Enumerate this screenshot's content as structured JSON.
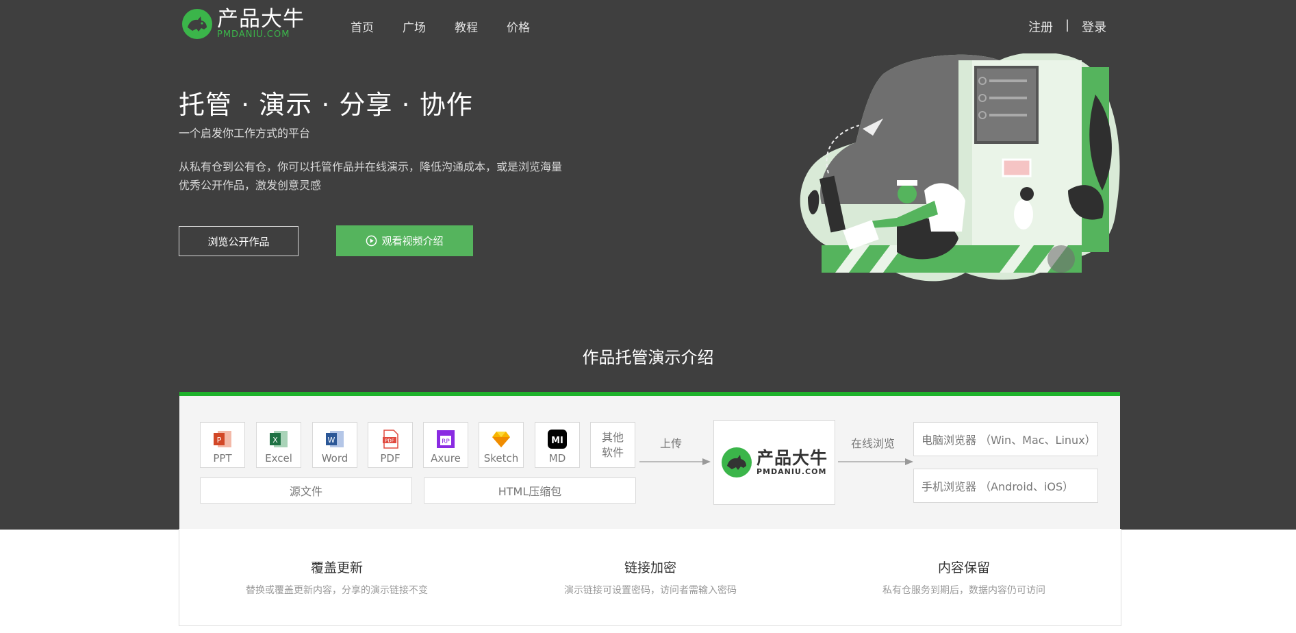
{
  "brand": {
    "name_cn": "产品大牛",
    "name_en": "PMDANIU.COM",
    "accent": "#3bb54a"
  },
  "nav": {
    "items": [
      "首页",
      "广场",
      "教程",
      "价格"
    ]
  },
  "auth": {
    "register": "注册",
    "separator": "|",
    "login": "登录"
  },
  "hero": {
    "title": "托管 · 演示 · 分享 · 协作",
    "subtitle": "一个启发你工作方式的平台",
    "description": "从私有仓到公有仓，你可以托管作品并在线演示，降低沟通成本，或是浏览海量优秀公开作品，激发创意灵感",
    "btn_browse": "浏览公开作品",
    "btn_video": "观看视频介绍"
  },
  "section": {
    "title": "作品托管演示介绍",
    "file_types": [
      {
        "label": "PPT",
        "icon": "ppt-icon",
        "color": "#d24726"
      },
      {
        "label": "Excel",
        "icon": "excel-icon",
        "color": "#1f7244"
      },
      {
        "label": "Word",
        "icon": "word-icon",
        "color": "#2b5797"
      },
      {
        "label": "PDF",
        "icon": "pdf-icon",
        "color": "#e04a3f"
      },
      {
        "label": "Axure",
        "icon": "axure-icon",
        "color": "#8a2be2"
      },
      {
        "label": "Sketch",
        "icon": "sketch-icon",
        "color": "#f7b500"
      },
      {
        "label": "MD",
        "icon": "markdown-icon",
        "color": "#000000"
      }
    ],
    "other_software": "其他软件",
    "group_source": "源文件",
    "group_html": "HTML压缩包",
    "upload_label": "上传",
    "online_label": "在线浏览",
    "center_cn": "产品大牛",
    "center_en": "PMDANIU.COM",
    "browser_pc": "电脑浏览器 （Win、Mac、Linux）",
    "browser_mobile": "手机浏览器 （Android、iOS）"
  },
  "features": [
    {
      "title": "覆盖更新",
      "desc": "替换或覆盖更新内容，分享的演示链接不变"
    },
    {
      "title": "链接加密",
      "desc": "演示链接可设置密码，访问者需输入密码"
    },
    {
      "title": "内容保留",
      "desc": "私有仓服务到期后，数据内容仍可访问"
    }
  ]
}
